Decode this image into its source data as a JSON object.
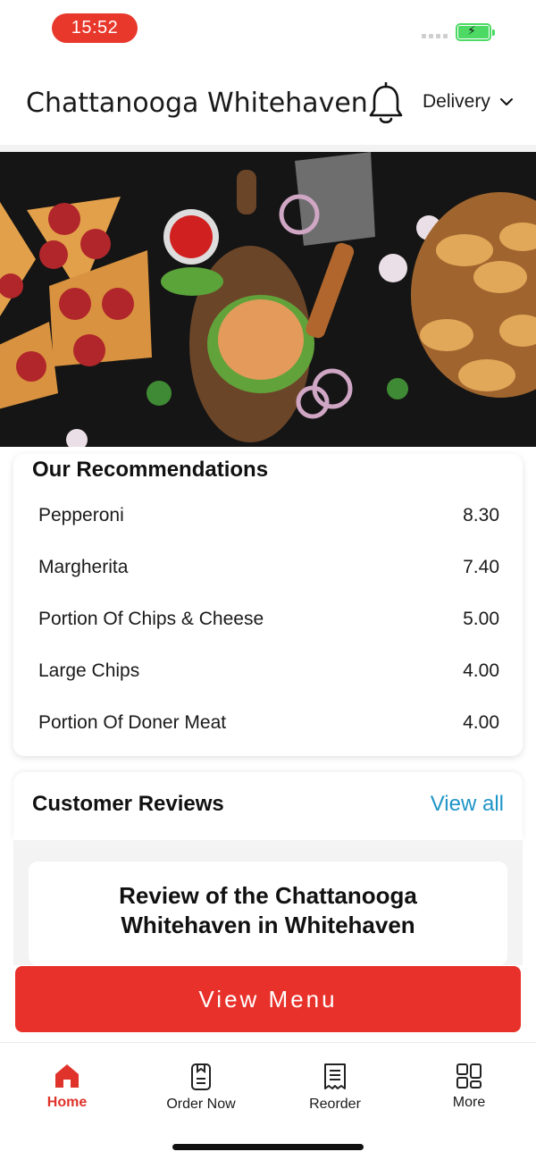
{
  "status_bar": {
    "time": "15:52",
    "battery_color": "#4cd964"
  },
  "header": {
    "store_name": "Chattanooga Whitehaven",
    "bell_icon": "bell-icon",
    "order_mode": "Delivery",
    "chevron_icon": "chevron-down-icon"
  },
  "recommendations": {
    "title": "Our Recommendations",
    "items": [
      {
        "name": "Pepperoni",
        "price": "8.30"
      },
      {
        "name": "Margherita",
        "price": "7.40"
      },
      {
        "name": "Portion Of Chips & Cheese",
        "price": "5.00"
      },
      {
        "name": "Large Chips",
        "price": "4.00"
      },
      {
        "name": "Portion Of Doner Meat",
        "price": "4.00"
      }
    ]
  },
  "reviews": {
    "title": "Customer Reviews",
    "view_all": "View all",
    "review_heading": "Review of the Chattanooga Whitehaven in Whitehaven"
  },
  "view_menu_label": "View Menu",
  "tabbar": {
    "items": [
      {
        "label": "Home",
        "icon": "home-icon",
        "active": true
      },
      {
        "label": "Order Now",
        "icon": "order-icon",
        "active": false
      },
      {
        "label": "Reorder",
        "icon": "receipt-icon",
        "active": false
      },
      {
        "label": "More",
        "icon": "grid-icon",
        "active": false
      }
    ]
  },
  "colors": {
    "accent": "#e8312a",
    "link": "#1f95c7"
  }
}
